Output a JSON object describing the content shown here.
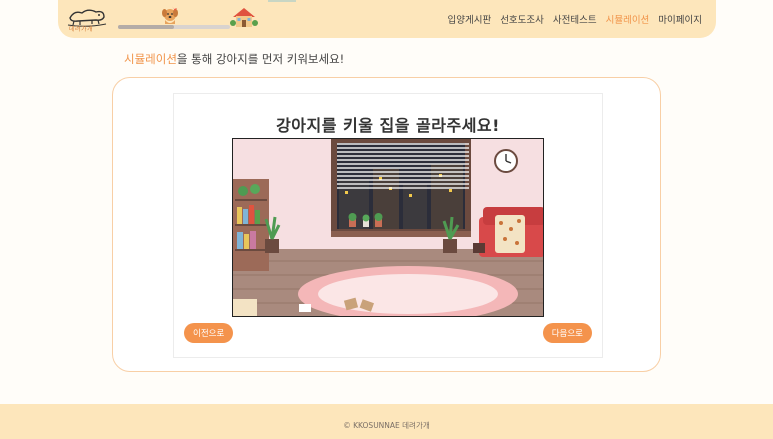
{
  "header": {
    "logo_text": "데려가개",
    "progress_fraction": 0.5,
    "nav": [
      {
        "label": "입양게시판",
        "active": false
      },
      {
        "label": "선호도조사",
        "active": false
      },
      {
        "label": "사전테스트",
        "active": false
      },
      {
        "label": "시뮬레이션",
        "active": true
      },
      {
        "label": "마이페이지",
        "active": false
      }
    ]
  },
  "main": {
    "subtitle_highlight": "시뮬레이션",
    "subtitle_rest": "을 통해 강아지를 먼저 키워보세요!",
    "question": "강아지를 키울 집을 골라주세요!",
    "prev_label": "이전으로",
    "next_label": "다음으로"
  },
  "footer": {
    "copyright": "© KKOSUNNAE 데려가개"
  },
  "colors": {
    "accent": "#f4934c",
    "header_bg": "#fde6bb",
    "card_border": "#f8cfa6"
  }
}
